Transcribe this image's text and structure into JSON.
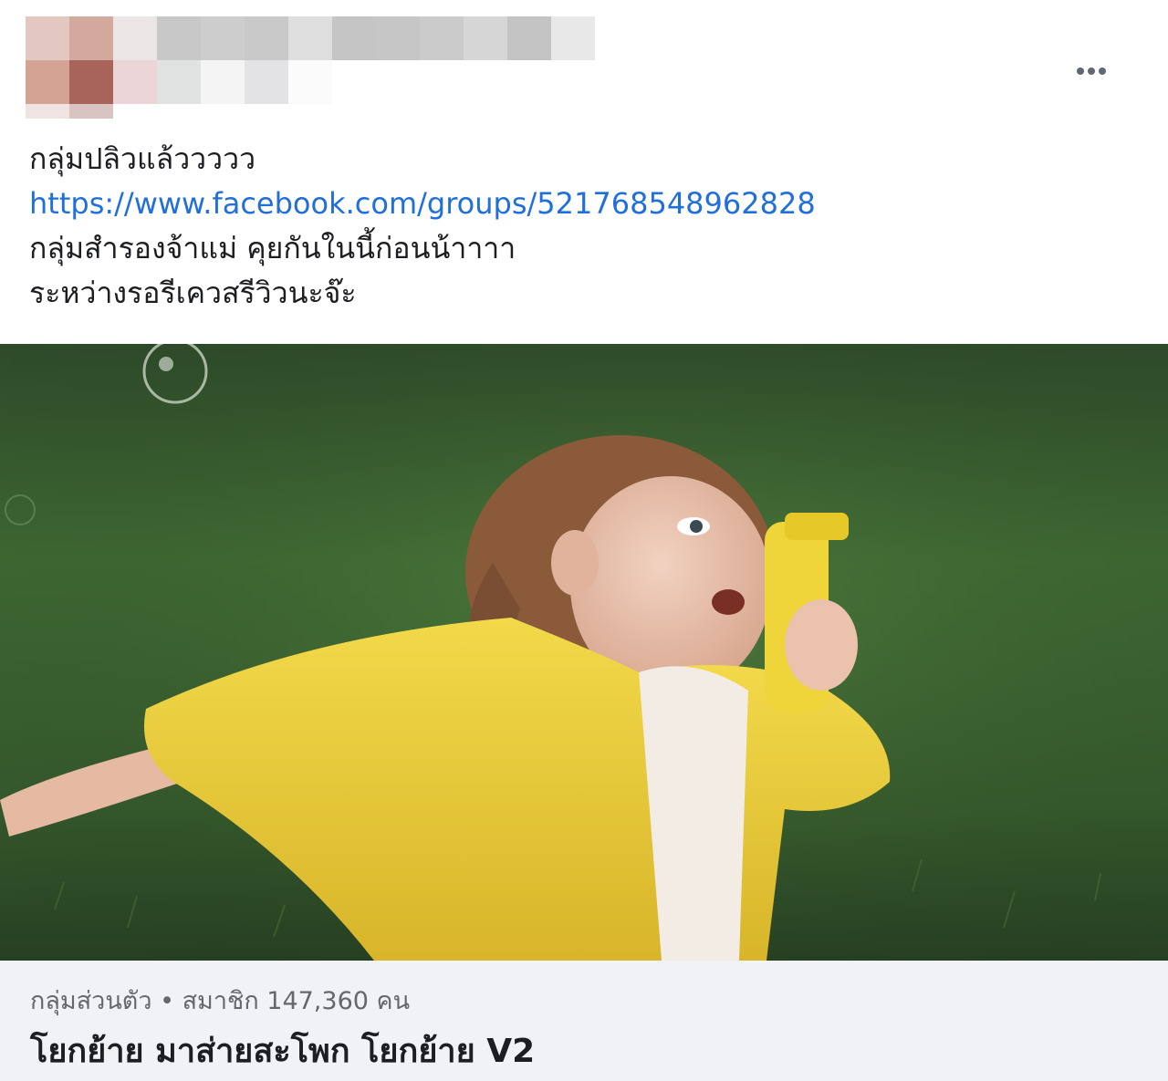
{
  "post": {
    "more_options_icon": "more-horizontal-icon",
    "text_lines": [
      "กลุ่มปลิวแล้ววววว",
      "https://www.facebook.com/groups/521768548962828",
      "กลุ่มสำรองจ้าแม่ คุยกันในนี้ก่อนน้าาาา",
      "ระหว่างรอรีเควสรีวิวนะจ๊ะ"
    ]
  },
  "link_card": {
    "meta": "กลุ่มส่วนตัว • สมาชิก 147,360 คน",
    "title": "โยกย้าย มาส่ายสะโพก โยกย้าย V2"
  },
  "colors": {
    "link": "#216fdb",
    "card_background": "#f0f2f5",
    "meta_text": "#65676b"
  }
}
